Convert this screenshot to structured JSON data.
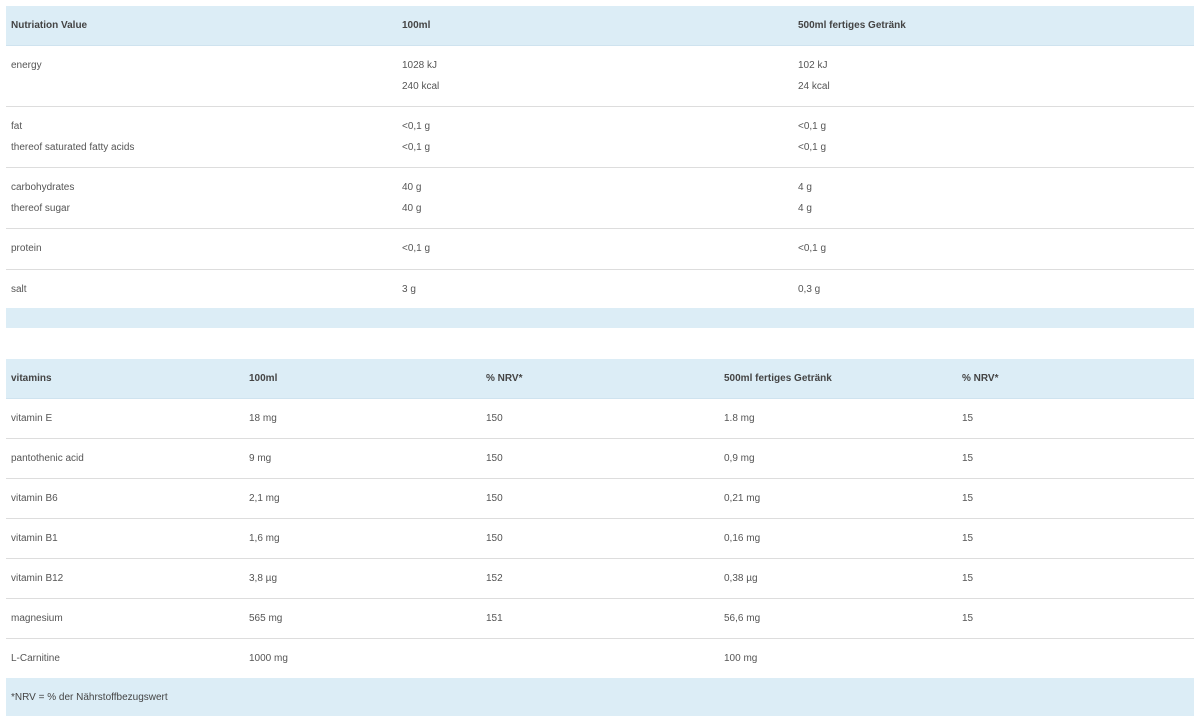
{
  "nutrition": {
    "headers": [
      "Nutriation Value",
      "100ml",
      "500ml fertiges Getränk"
    ],
    "rows": [
      {
        "label": [
          "energy"
        ],
        "per100": [
          "1028 kJ",
          "240 kcal"
        ],
        "per500": [
          "102 kJ",
          "24 kcal"
        ]
      },
      {
        "label": [
          "fat",
          "thereof saturated fatty acids"
        ],
        "per100": [
          "<0,1 g",
          "<0,1 g"
        ],
        "per500": [
          "<0,1 g",
          "<0,1 g"
        ]
      },
      {
        "label": [
          "carbohydrates",
          "thereof sugar"
        ],
        "per100": [
          "40 g",
          "40 g"
        ],
        "per500": [
          "4 g",
          "4 g"
        ]
      },
      {
        "label": [
          "protein"
        ],
        "per100": [
          "<0,1 g"
        ],
        "per500": [
          "<0,1 g"
        ]
      },
      {
        "label": [
          "salt"
        ],
        "per100": [
          "3 g"
        ],
        "per500": [
          "0,3 g"
        ]
      }
    ]
  },
  "vitamins": {
    "headers": [
      "vitamins",
      "100ml",
      "% NRV*",
      "500ml fertiges Getränk",
      "% NRV*"
    ],
    "rows": [
      [
        "vitamin E",
        "18 mg",
        "150",
        "1.8 mg",
        "15"
      ],
      [
        "pantothenic acid",
        "9 mg",
        "150",
        "0,9 mg",
        "15"
      ],
      [
        "vitamin B6",
        "2,1 mg",
        "150",
        "0,21 mg",
        "15"
      ],
      [
        "vitamin B1",
        "1,6 mg",
        "150",
        "0,16 mg",
        "15"
      ],
      [
        "vitamin B12",
        "3,8 µg",
        "152",
        "0,38 µg",
        "15"
      ],
      [
        "magnesium",
        "565 mg",
        "151",
        "56,6 mg",
        "15"
      ],
      [
        "L-Carnitine",
        "1000 mg",
        "",
        "100 mg",
        ""
      ]
    ],
    "footnote": "*NRV = % der Nährstoffbezugswert"
  },
  "colors": {
    "header_bg": "#dcedf6",
    "row_border": "#dddddd",
    "text": "#555555"
  }
}
